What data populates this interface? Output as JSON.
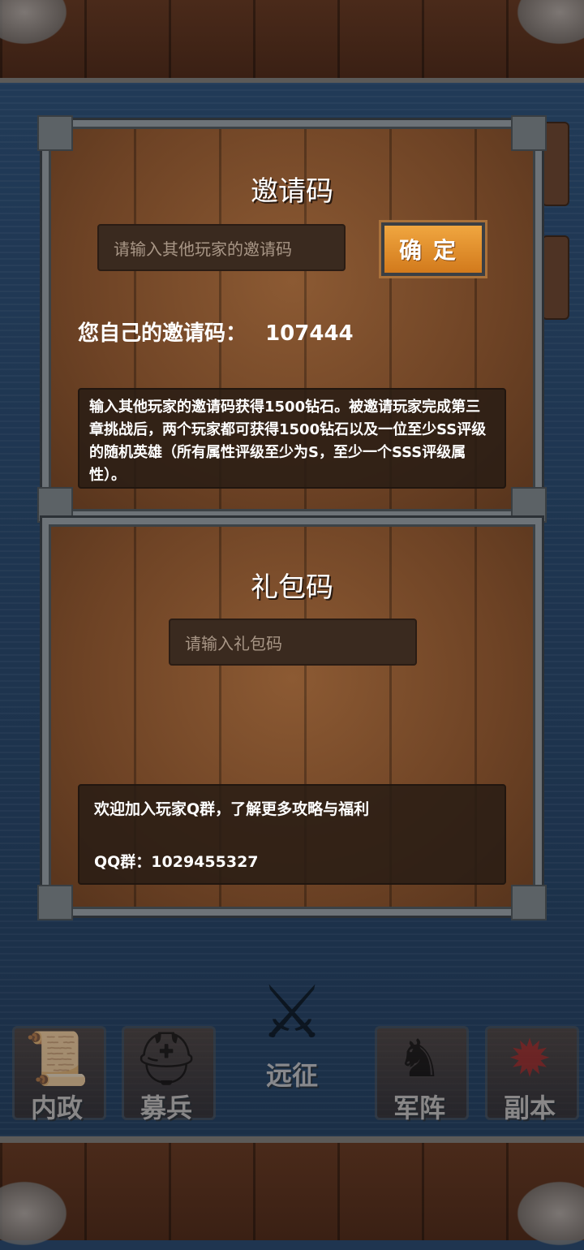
{
  "invite": {
    "title": "邀请码",
    "input_placeholder": "请输入其他玩家的邀请码",
    "confirm_label": "确定",
    "own_code_label": "您自己的邀请码：",
    "own_code_value": "107444",
    "description": "输入其他玩家的邀请码获得1500钻石。被邀请玩家完成第三章挑战后，两个玩家都可获得1500钻石以及一位至少SS评级的随机英雄（所有属性评级至少为S，至少一个SSS评级属性）。"
  },
  "gift": {
    "title": "礼包码",
    "input_placeholder": "请输入礼包码",
    "qq_line1": "欢迎加入玩家Q群，了解更多攻略与福利",
    "qq_line2": "QQ群：1029455327"
  },
  "nav": {
    "items": [
      {
        "label": "内政",
        "icon": "scroll-icon"
      },
      {
        "label": "募兵",
        "icon": "helmet-icon"
      },
      {
        "label": "远征",
        "icon": "sword-emblem-icon"
      },
      {
        "label": "军阵",
        "icon": "chess-icon"
      },
      {
        "label": "副本",
        "icon": "demon-icon"
      }
    ]
  },
  "colors": {
    "accent": "#e8952f",
    "wood": "#7a4a2a",
    "background": "#1f3550"
  }
}
